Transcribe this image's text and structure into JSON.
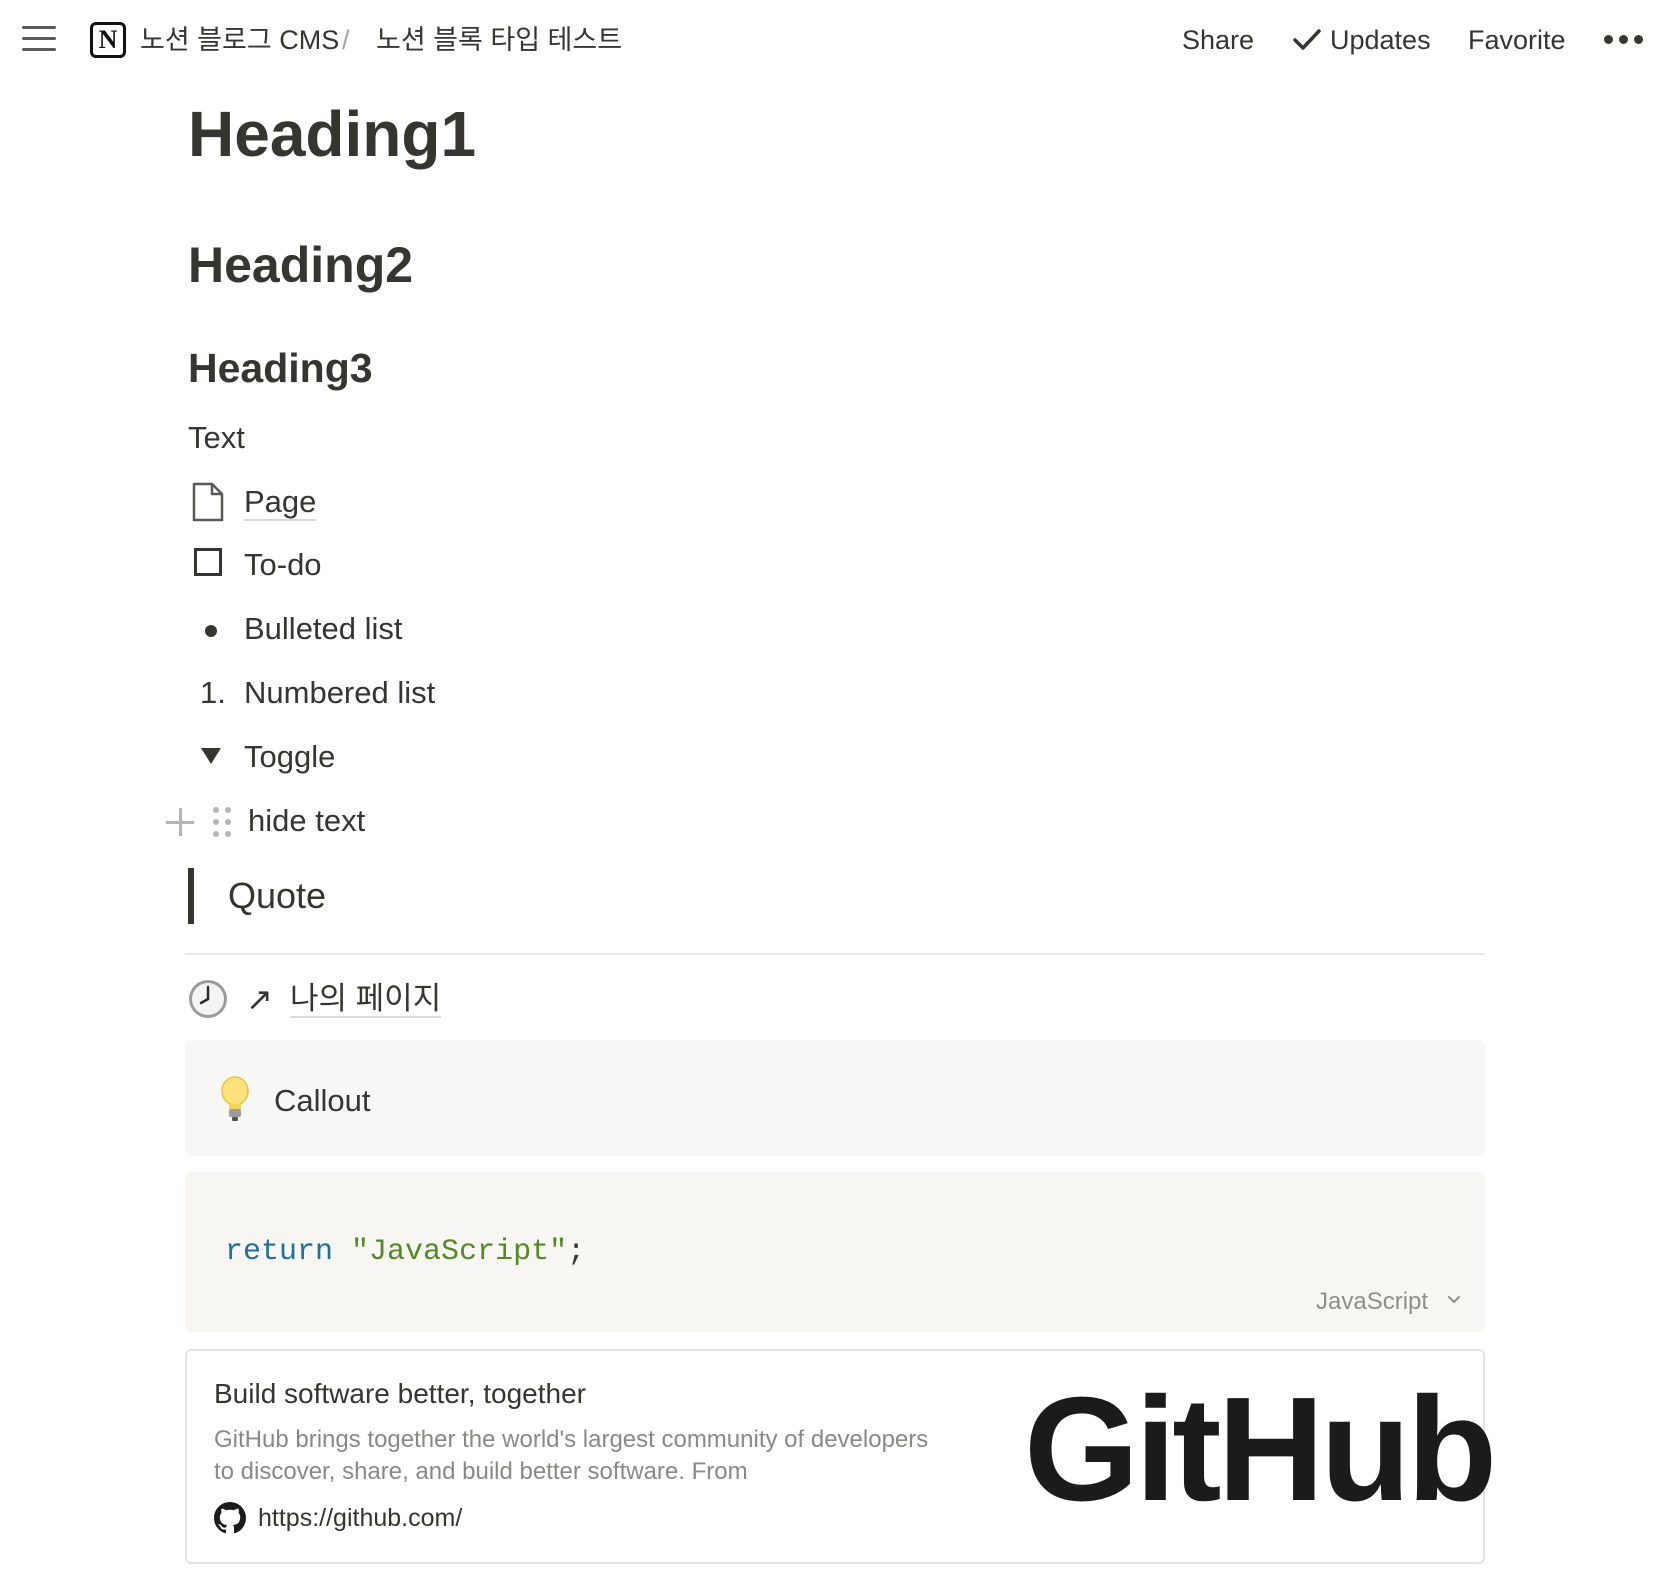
{
  "topbar": {
    "breadcrumb": [
      "노션 블로그 CMS",
      "노션 블록 타입 테스트"
    ],
    "separator": "/",
    "notion_logo_letter": "N",
    "actions": {
      "share": "Share",
      "updates": "Updates",
      "favorite": "Favorite"
    }
  },
  "blocks": {
    "heading1": "Heading1",
    "heading2": "Heading2",
    "heading3": "Heading3",
    "text": "Text",
    "page": "Page",
    "todo": "To-do",
    "bulleted": "Bulleted list",
    "numbered_marker": "1.",
    "numbered": "Numbered list",
    "toggle": "Toggle",
    "toggle_child": "hide text",
    "quote": "Quote",
    "link_page_arrow": "↗",
    "link_page": "나의 페이지",
    "callout": "Callout"
  },
  "code": {
    "keyword": "return",
    "string": "\"JavaScript\"",
    "terminator": ";",
    "language": "JavaScript"
  },
  "bookmark": {
    "title": "Build software better, together",
    "description": "GitHub brings together the world's largest community of developers to discover, share, and build better software. From",
    "url": "https://github.com/",
    "image_text": "GitHub"
  },
  "colors": {
    "text": "#37352f",
    "code_keyword": "#1f6f9f",
    "code_string": "#538a24",
    "callout_bg": "#f7f7f5",
    "code_bg": "#f7f6f3"
  }
}
